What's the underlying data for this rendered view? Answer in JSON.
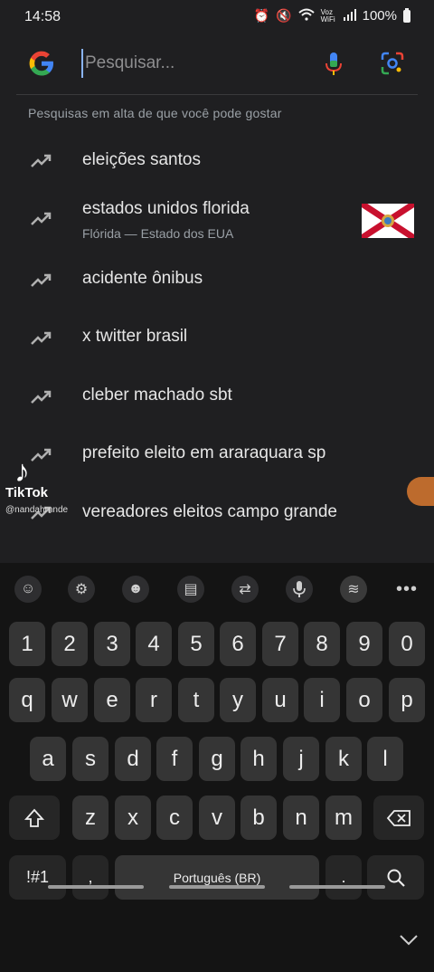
{
  "status": {
    "time": "14:58",
    "network": "Voz WiFi",
    "battery": "100%"
  },
  "search": {
    "placeholder": "Pesquisar..."
  },
  "section_title": "Pesquisas em alta de que você pode gostar",
  "suggestions": [
    {
      "text": "eleições santos"
    },
    {
      "text": "estados unidos florida",
      "subtitle": "Flórida — Estado dos EUA",
      "thumbnail": "florida-flag"
    },
    {
      "text": "acidente ônibus"
    },
    {
      "text": "x twitter brasil"
    },
    {
      "text": "cleber machado sbt"
    },
    {
      "text": "prefeito eleito em araraquara sp"
    },
    {
      "text": "vereadores eleitos campo grande"
    }
  ],
  "overlay": {
    "watermark": "TikTok",
    "username": "@nandahrnnde"
  },
  "keyboard": {
    "toolbar": [
      "emoji-sticker-icon",
      "settings-icon",
      "emoji-icon",
      "clipboard-icon",
      "translate-icon",
      "mic-icon",
      "spotify-icon",
      "more-icon"
    ],
    "row_numbers": [
      "1",
      "2",
      "3",
      "4",
      "5",
      "6",
      "7",
      "8",
      "9",
      "0"
    ],
    "row1": [
      "q",
      "w",
      "e",
      "r",
      "t",
      "y",
      "u",
      "i",
      "o",
      "p"
    ],
    "row2": [
      "a",
      "s",
      "d",
      "f",
      "g",
      "h",
      "j",
      "k",
      "l"
    ],
    "row3": [
      "z",
      "x",
      "c",
      "v",
      "b",
      "n",
      "m"
    ],
    "symbols_label": "!#1",
    "comma_label": ",",
    "space_label": "Português (BR)",
    "period_label": "."
  },
  "colors": {
    "background": "#1f1f21",
    "keyboard": "#141414",
    "key": "#353535",
    "accent": "#8ab4f8"
  }
}
